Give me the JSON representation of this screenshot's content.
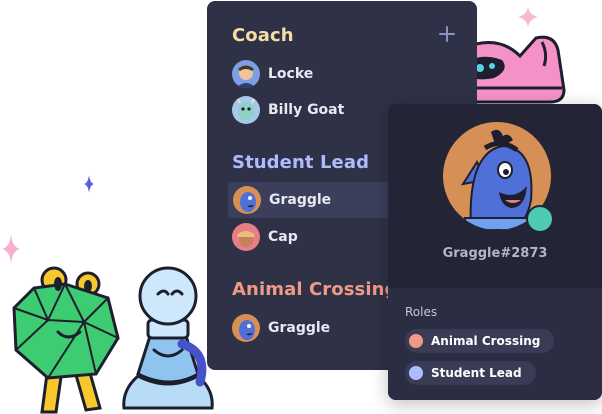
{
  "members": {
    "groups": [
      {
        "title": "Coach",
        "color": "#f5dea6",
        "members": [
          {
            "name": "Locke",
            "avatar": "locke-avatar"
          },
          {
            "name": "Billy Goat",
            "avatar": "billy-goat-avatar"
          }
        ]
      },
      {
        "title": "Student Lead",
        "color": "#aebcff",
        "members": [
          {
            "name": "Graggle",
            "avatar": "graggle-avatar",
            "active": true
          },
          {
            "name": "Cap",
            "avatar": "cap-avatar"
          }
        ]
      },
      {
        "title": "Animal Crossing",
        "color": "#ef9a87",
        "members": [
          {
            "name": "Graggle",
            "avatar": "graggle-avatar"
          }
        ]
      }
    ],
    "add_icon": "plus-icon"
  },
  "profile": {
    "username": "Graggle#2873",
    "status_color": "#4ccbb0",
    "roles_label": "Roles",
    "roles": [
      {
        "name": "Animal Crossing",
        "color": "#ef9a87"
      },
      {
        "name": "Student Lead",
        "color": "#aebcff"
      }
    ]
  }
}
